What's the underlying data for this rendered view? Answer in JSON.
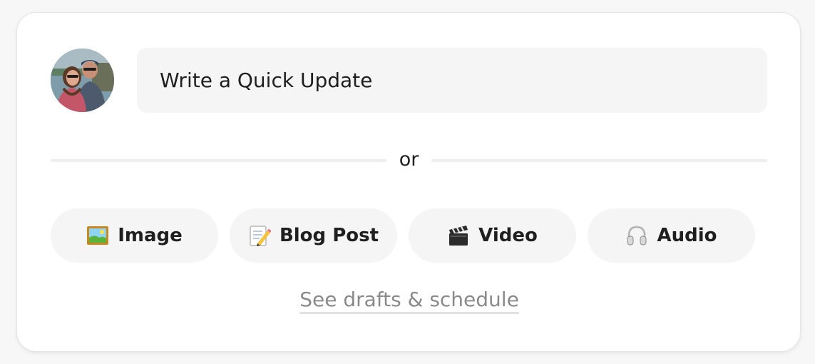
{
  "composer": {
    "placeholder": "Write a Quick Update"
  },
  "divider": {
    "label": "or"
  },
  "media_buttons": [
    {
      "label": "Image",
      "icon": "framed-picture-icon"
    },
    {
      "label": "Blog Post",
      "icon": "memo-pencil-icon"
    },
    {
      "label": "Video",
      "icon": "clapper-board-icon"
    },
    {
      "label": "Audio",
      "icon": "headphones-icon"
    }
  ],
  "drafts_link": {
    "label": "See drafts & schedule"
  },
  "colors": {
    "card_background": "#ffffff",
    "field_background": "#f5f5f5",
    "text": "#1f1f1f",
    "link_text": "#8a8a8a"
  }
}
